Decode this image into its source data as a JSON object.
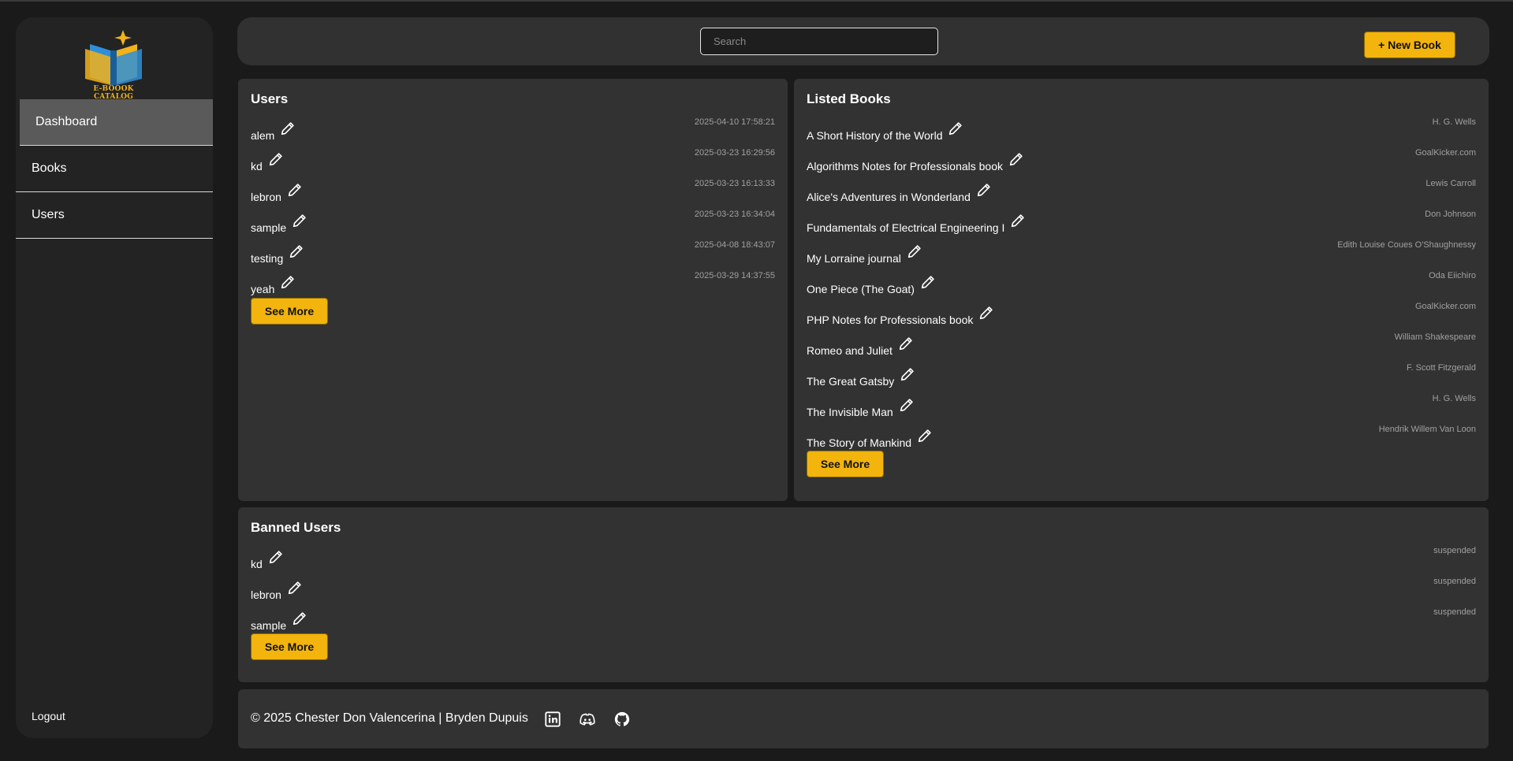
{
  "sidebar": {
    "logo_text": "E-BOOOK CATALOG",
    "nav": [
      {
        "label": "Dashboard"
      },
      {
        "label": "Books"
      },
      {
        "label": "Users"
      }
    ],
    "logout": "Logout"
  },
  "topbar": {
    "search_placeholder": "Search",
    "new_book": "+ New Book"
  },
  "users": {
    "title": "Users",
    "items": [
      {
        "name": "alem",
        "date": "2025-04-10 17:58:21"
      },
      {
        "name": "kd",
        "date": "2025-03-23 16:29:56"
      },
      {
        "name": "lebron",
        "date": "2025-03-23 16:13:33"
      },
      {
        "name": "sample",
        "date": "2025-03-23 16:34:04"
      },
      {
        "name": "testing",
        "date": "2025-04-08 18:43:07"
      },
      {
        "name": "yeah",
        "date": "2025-03-29 14:37:55"
      }
    ],
    "see_more": "See More"
  },
  "books": {
    "title": "Listed Books",
    "items": [
      {
        "title": "A Short History of the World",
        "author": "H. G. Wells"
      },
      {
        "title": "Algorithms Notes for Professionals book",
        "author": "GoalKicker.com"
      },
      {
        "title": "Alice's Adventures in Wonderland",
        "author": "Lewis Carroll"
      },
      {
        "title": "Fundamentals of Electrical Engineering I",
        "author": "Don Johnson"
      },
      {
        "title": "My Lorraine journal",
        "author": "Edith Louise Coues O'Shaughnessy"
      },
      {
        "title": "One Piece (The Goat)",
        "author": "Oda Eiichiro"
      },
      {
        "title": "PHP Notes for Professionals book",
        "author": "GoalKicker.com"
      },
      {
        "title": "Romeo and Juliet",
        "author": "William Shakespeare"
      },
      {
        "title": "The Great Gatsby",
        "author": "F. Scott Fitzgerald"
      },
      {
        "title": "The Invisible Man",
        "author": "H. G. Wells"
      },
      {
        "title": "The Story of Mankind",
        "author": "Hendrik Willem Van Loon"
      }
    ],
    "see_more": "See More"
  },
  "banned": {
    "title": "Banned Users",
    "items": [
      {
        "name": "kd",
        "status": "suspended"
      },
      {
        "name": "lebron",
        "status": "suspended"
      },
      {
        "name": "sample",
        "status": "suspended"
      }
    ],
    "see_more": "See More"
  },
  "footer": {
    "text": "© 2025 Chester Don Valencerina | Bryden Dupuis",
    "icons": [
      "linkedin-icon",
      "discord-icon",
      "github-icon"
    ]
  },
  "colors": {
    "accent": "#f2b40d",
    "panel": "#323232",
    "background": "#1a1a1a"
  }
}
